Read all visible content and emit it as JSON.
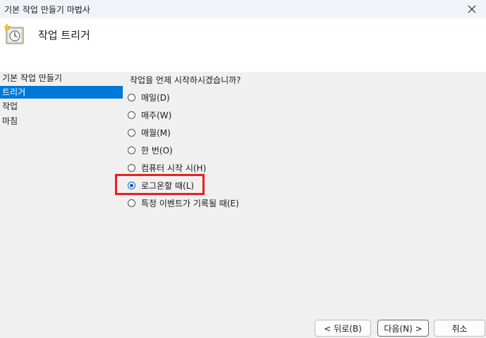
{
  "window": {
    "title": "기본 작업 만들기 마법사"
  },
  "header": {
    "title": "작업 트리거",
    "icon": "clock-task-icon"
  },
  "sidebar": {
    "items": [
      {
        "label": "기본 작업 만들기",
        "active": false
      },
      {
        "label": "트리거",
        "active": true
      },
      {
        "label": "작업",
        "active": false
      },
      {
        "label": "마침",
        "active": false
      }
    ]
  },
  "main": {
    "question": "작업을 언제 시작하시겠습니까?",
    "options": [
      {
        "label": "매일(D)",
        "checked": false
      },
      {
        "label": "매주(W)",
        "checked": false
      },
      {
        "label": "매월(M)",
        "checked": false
      },
      {
        "label": "한 번(O)",
        "checked": false
      },
      {
        "label": "컴퓨터 시작 시(H)",
        "checked": false
      },
      {
        "label": "로그온할 때(L)",
        "checked": true
      },
      {
        "label": "특정 이벤트가 기록될 때(E)",
        "checked": false
      }
    ]
  },
  "buttons": {
    "back": "< 뒤로(B)",
    "next": "다음(N) >",
    "cancel": "취소"
  },
  "colors": {
    "selection": "#0078d7",
    "highlight_box": "#e8201e",
    "radio_accent": "#005fb8"
  }
}
